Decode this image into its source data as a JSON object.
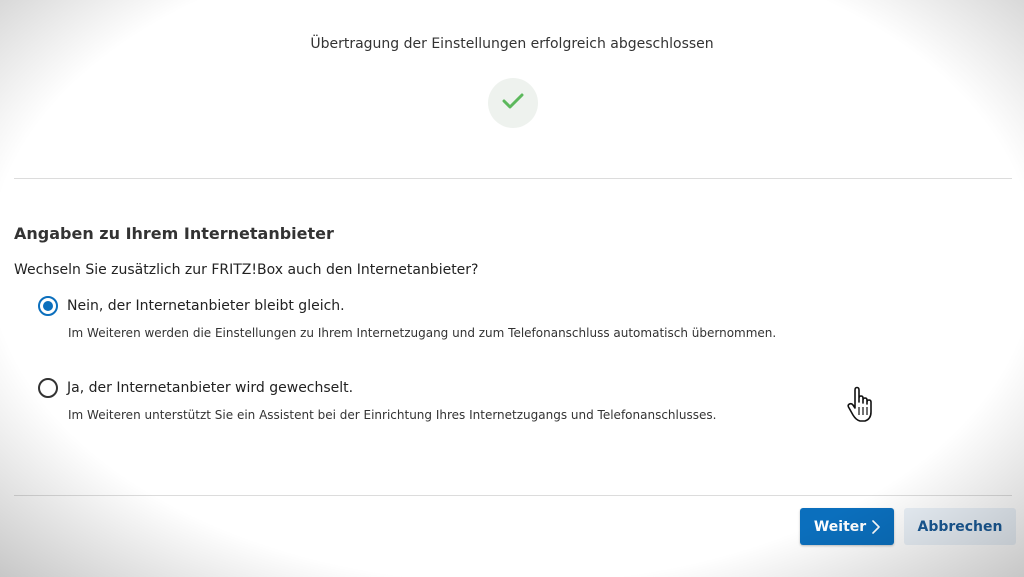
{
  "success": {
    "title": "Übertragung der Einstellungen erfolgreich abgeschlossen",
    "icon": "check-icon",
    "icon_color": "#5cb85c"
  },
  "section": {
    "title": "Angaben zu Ihrem Internetanbieter",
    "question": "Wechseln Sie zusätzlich zur FRITZ!Box auch den Internetanbieter?"
  },
  "options": [
    {
      "label": "Nein, der Internetanbieter bleibt gleich.",
      "description": "Im Weiteren werden die Einstellungen zu Ihrem Internetzugang und zum Telefonanschluss automatisch übernommen.",
      "selected": true
    },
    {
      "label": "Ja, der Internetanbieter wird gewechselt.",
      "description": "Im Weiteren unterstützt Sie ein Assistent bei der Einrichtung Ihres Internetzugangs und Telefonanschlusses.",
      "selected": false
    }
  ],
  "buttons": {
    "next_label": "Weiter",
    "cancel_label": "Abbrechen"
  },
  "colors": {
    "accent": "#0b6fbd",
    "cancel_bg": "#eaf1f8",
    "cancel_text": "#1a5a96"
  }
}
